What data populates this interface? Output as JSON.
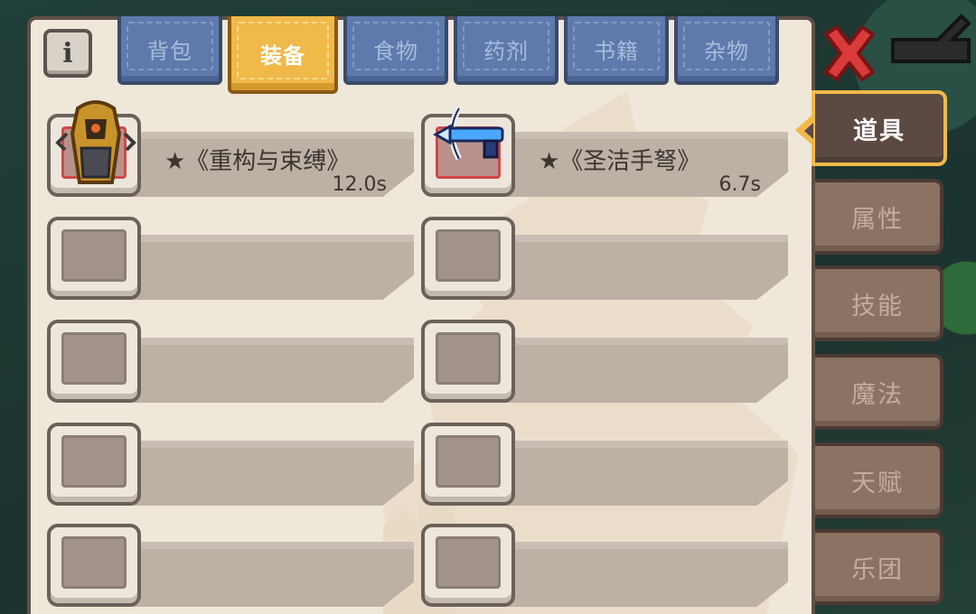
{
  "tabs": [
    {
      "label": "背包",
      "active": false
    },
    {
      "label": "装备",
      "active": true
    },
    {
      "label": "食物",
      "active": false
    },
    {
      "label": "药剂",
      "active": false
    },
    {
      "label": "书籍",
      "active": false
    },
    {
      "label": "杂物",
      "active": false
    }
  ],
  "side_tabs": [
    {
      "label": "道具",
      "active": true
    },
    {
      "label": "属性",
      "active": false
    },
    {
      "label": "技能",
      "active": false
    },
    {
      "label": "魔法",
      "active": false
    },
    {
      "label": "天赋",
      "active": false
    },
    {
      "label": "乐团",
      "active": false
    }
  ],
  "info_button": {
    "icon": "info-icon",
    "glyph": "i"
  },
  "close_button": {
    "icon": "close-icon"
  },
  "equipment": [
    {
      "name": "★《重构与束缚》",
      "time": "12.0s",
      "icon": "armor-icon"
    },
    {
      "name": "★《圣洁手弩》",
      "time": "6.7s",
      "icon": "crossbow-icon"
    }
  ],
  "empty_slot_count": 8,
  "colors": {
    "active_tab": "#f0b949",
    "inactive_tab": "#5e7aad",
    "side_tab": "#8c7263",
    "close": "#d93a3a",
    "panel": "#efe7da"
  }
}
